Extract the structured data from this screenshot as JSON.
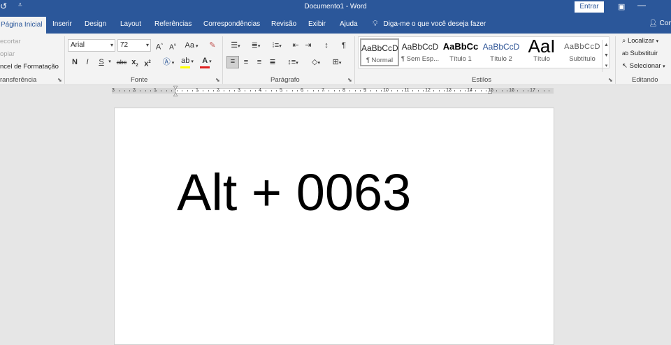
{
  "app": {
    "document_title": "Documento1  -  Word",
    "signin_label": "Entrar",
    "share_label": "Com"
  },
  "tabs": [
    {
      "label": "Página Inicial",
      "active": true
    },
    {
      "label": "Inserir"
    },
    {
      "label": "Design"
    },
    {
      "label": "Layout"
    },
    {
      "label": "Referências"
    },
    {
      "label": "Correspondências"
    },
    {
      "label": "Revisão"
    },
    {
      "label": "Exibir"
    },
    {
      "label": "Ajuda"
    }
  ],
  "tell_me": "Diga-me o que você deseja fazer",
  "clipboard": {
    "cut": "ecortar",
    "copy": "opiar",
    "format_painter": "ncel de Formatação",
    "group_label": "ransferência"
  },
  "font": {
    "name": "Arial",
    "size": "72",
    "group_label": "Fonte",
    "grow": "A",
    "shrink": "A",
    "case": "Aa",
    "bold": "N",
    "italic": "I",
    "underline": "S",
    "strike": "abc",
    "subscript": "x",
    "superscript": "x",
    "font_color_letter": "A",
    "font_color": "#e02020",
    "highlight_color": "#ffff00"
  },
  "paragraph": {
    "group_label": "Parágrafo"
  },
  "styles": {
    "group_label": "Estilos",
    "items": [
      {
        "sample": "AaBbCcD",
        "name": "¶ Normal"
      },
      {
        "sample": "AaBbCcD",
        "name": "¶ Sem Esp..."
      },
      {
        "sample": "AaBbCc",
        "name": "Título 1"
      },
      {
        "sample": "AaBbCcD",
        "name": "Título 2"
      },
      {
        "sample": "AaI",
        "name": "Título"
      },
      {
        "sample": "AaBbCcD",
        "name": "Subtítulo"
      }
    ]
  },
  "editing": {
    "find": "Localizar",
    "replace": "Substituir",
    "select": "Selecionar",
    "group_label": "Editando"
  },
  "ruler": {
    "numbers": [
      "3",
      "2",
      "1",
      "1",
      "2",
      "3",
      "4",
      "5",
      "6",
      "7",
      "8",
      "9",
      "10",
      "11",
      "12",
      "13",
      "14",
      "15",
      "16",
      "17"
    ]
  },
  "document": {
    "text": "Alt + 0063"
  },
  "colors": {
    "brand": "#2b579a",
    "ribbon_bg": "#f3f3f3",
    "workspace_bg": "#e6e6e6"
  }
}
